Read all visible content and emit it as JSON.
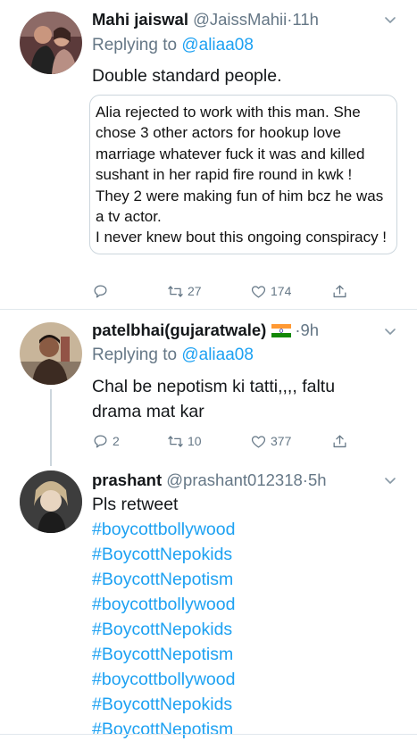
{
  "tweets": [
    {
      "name": "Mahi jaiswal",
      "handle": "@JaissMahii",
      "dot": "·",
      "time": "11h",
      "replying_prefix": "Replying to",
      "replying_to": "@aliaa08",
      "text": "Double standard people.",
      "quote": "Alia rejected to work with this man. She chose 3 other actors for hookup love marriage whatever fuck it was and killed sushant in her rapid fire round in kwk ! They 2 were making fun of him bcz he was a tv actor.\nI never knew bout this ongoing conspiracy !",
      "counts": {
        "replies": "",
        "retweets": "27",
        "likes": "174"
      }
    },
    {
      "name": "patelbhai(gujaratwale)",
      "flag_icon": "india-flag-icon",
      "handle": "",
      "dot": "·",
      "time": "9h",
      "replying_prefix": "Replying to",
      "replying_to": "@aliaa08",
      "text": "Chal be nepotism ki tatti,,,, faltu drama mat kar",
      "counts": {
        "replies": "2",
        "retweets": "10",
        "likes": "377"
      }
    },
    {
      "name": "prashant",
      "handle": "@prashant012318",
      "dot": "·",
      "time": "5h",
      "text": "Pls retweet",
      "hashtags": [
        "#boycottbollywood",
        "#BoycottNepokids",
        "#BoycottNepotism",
        "#boycottbollywood",
        "#BoycottNepokids",
        "#BoycottNepotism",
        "#boycottbollywood",
        "#BoycottNepokids",
        "#BoycottNepotism"
      ]
    }
  ],
  "colors": {
    "link": "#1da1f2",
    "secondary": "#657786",
    "divider": "#e1e8ed",
    "thread_line": "#ccd6dd"
  },
  "icons": [
    "reply-icon",
    "retweet-icon",
    "like-icon",
    "share-icon",
    "chevron-down-icon"
  ]
}
